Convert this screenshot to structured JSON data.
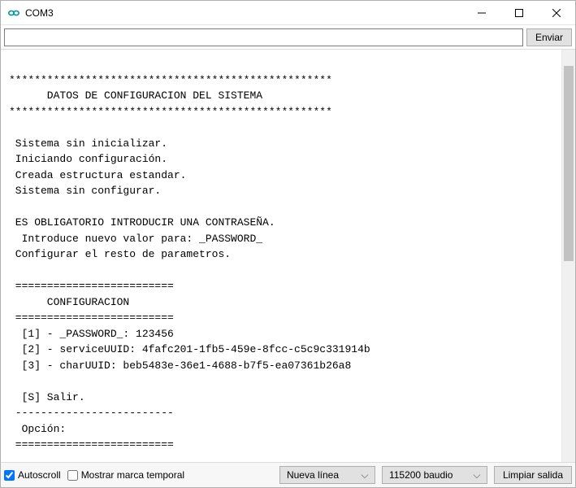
{
  "window": {
    "title": "COM3"
  },
  "input": {
    "value": "",
    "placeholder": ""
  },
  "buttons": {
    "send": "Enviar",
    "clear": "Limpiar salida"
  },
  "console": {
    "text": "\n***************************************************\n      DATOS DE CONFIGURACION DEL SISTEMA\n***************************************************\n\n Sistema sin inicializar.\n Iniciando configuración.\n Creada estructura estandar.\n Sistema sin configurar.\n\n ES OBLIGATORIO INTRODUCIR UNA CONTRASEÑA.\n  Introduce nuevo valor para: _PASSWORD_\n Configurar el resto de parametros.\n\n =========================\n      CONFIGURACION\n =========================\n  [1] - _PASSWORD_: 123456\n  [2] - serviceUUID: 4fafc201-1fb5-459e-8fcc-c5c9c331914b\n  [3] - charUUID: beb5483e-36e1-4688-b7f5-ea07361b26a8\n\n  [S] Salir.\n -------------------------\n  Opción:\n ========================="
  },
  "bottombar": {
    "autoscroll_label": "Autoscroll",
    "autoscroll_checked": true,
    "timestamp_label": "Mostrar marca temporal",
    "timestamp_checked": false,
    "line_ending": "Nueva línea",
    "baud": "115200 baudio"
  }
}
